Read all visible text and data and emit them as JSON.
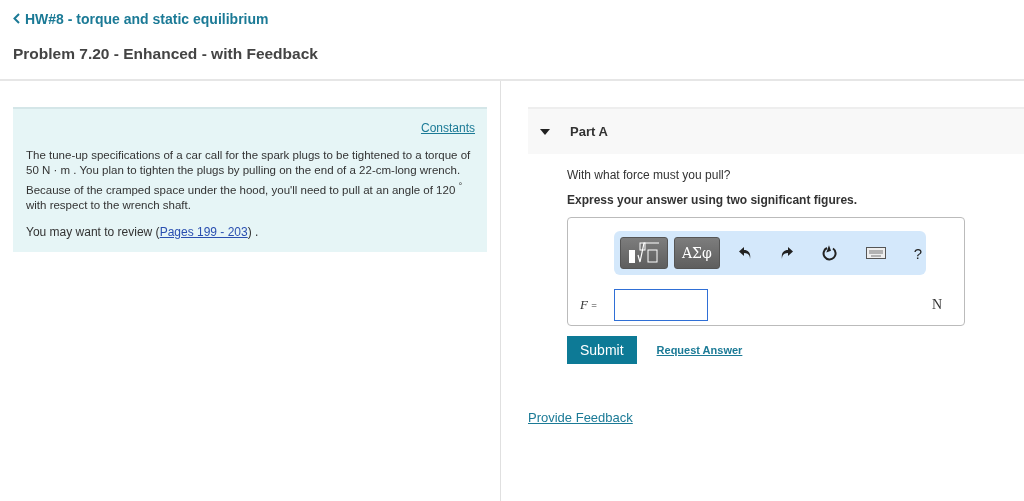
{
  "breadcrumb": {
    "label": "HW#8 - torque and static equilibrium"
  },
  "title": "Problem 7.20 - Enhanced - with Feedback",
  "intro": {
    "constants_link": "Constants",
    "text": "The tune-up specifications of a car call for the spark plugs to be tightened to a torque of 50  N · m . You plan to tighten the plugs by pulling on the end of a 22-cm-long wrench. Because of the cramped space under the hood, you'll need to pull at an angle of 120 $^{°}$ with respect to the wrench shaft.",
    "review_text": "You may want to review (",
    "review_link": "Pages 199 - 203",
    "review_end": ") ."
  },
  "part": {
    "title": "Part A",
    "expanded": true,
    "question": "With what force must you pull?",
    "instruction": "Express your answer using two significant figures.",
    "toolbar": {
      "symbols_button": "ΑΣφ",
      "help_button": "?"
    },
    "variable": "F",
    "equals": "=",
    "unit": "N",
    "submit": "Submit",
    "request_answer": "Request Answer"
  },
  "feedback_link": "Provide Feedback"
}
